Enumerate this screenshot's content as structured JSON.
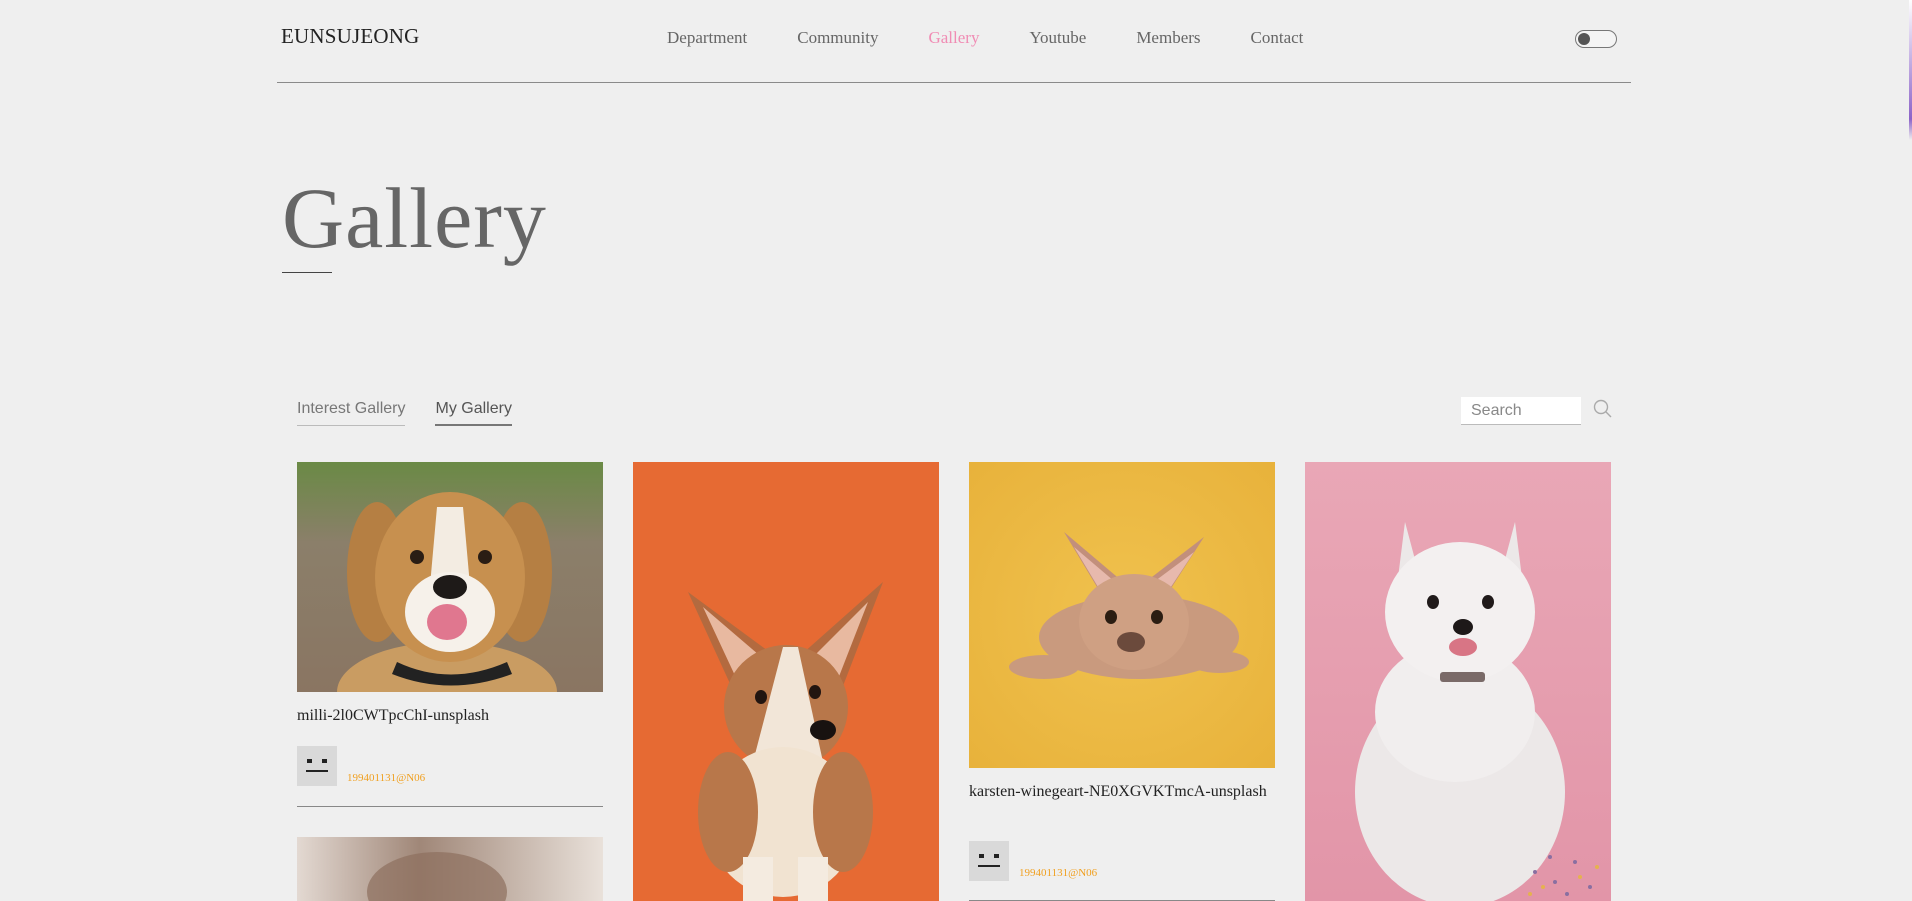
{
  "header": {
    "logo": "EUNSUJEONG",
    "nav": [
      "Department",
      "Community",
      "Gallery",
      "Youtube",
      "Members",
      "Contact"
    ],
    "active_nav": "Gallery",
    "accent_color": "#f08cb4"
  },
  "main": {
    "title": "Gallery",
    "tabs": [
      {
        "label": "Interest Gallery",
        "active": false
      },
      {
        "label": "My Gallery",
        "active": true
      }
    ],
    "search": {
      "placeholder": "Search",
      "value": ""
    }
  },
  "gallery": [
    {
      "caption": "milli-2l0CWTpcChI-unsplash",
      "user": "199401131@N06",
      "subject": "beagle on dirt path"
    },
    {
      "caption": "",
      "user": "",
      "subject": "corgi puppy on orange background"
    },
    {
      "caption": "karsten-winegeart-NE0XGVKTmcA-unsplash",
      "user": "199401131@N06",
      "subject": "french bulldog on yellow background"
    },
    {
      "caption": "",
      "user": "",
      "subject": "white samoyed on pink background"
    }
  ]
}
